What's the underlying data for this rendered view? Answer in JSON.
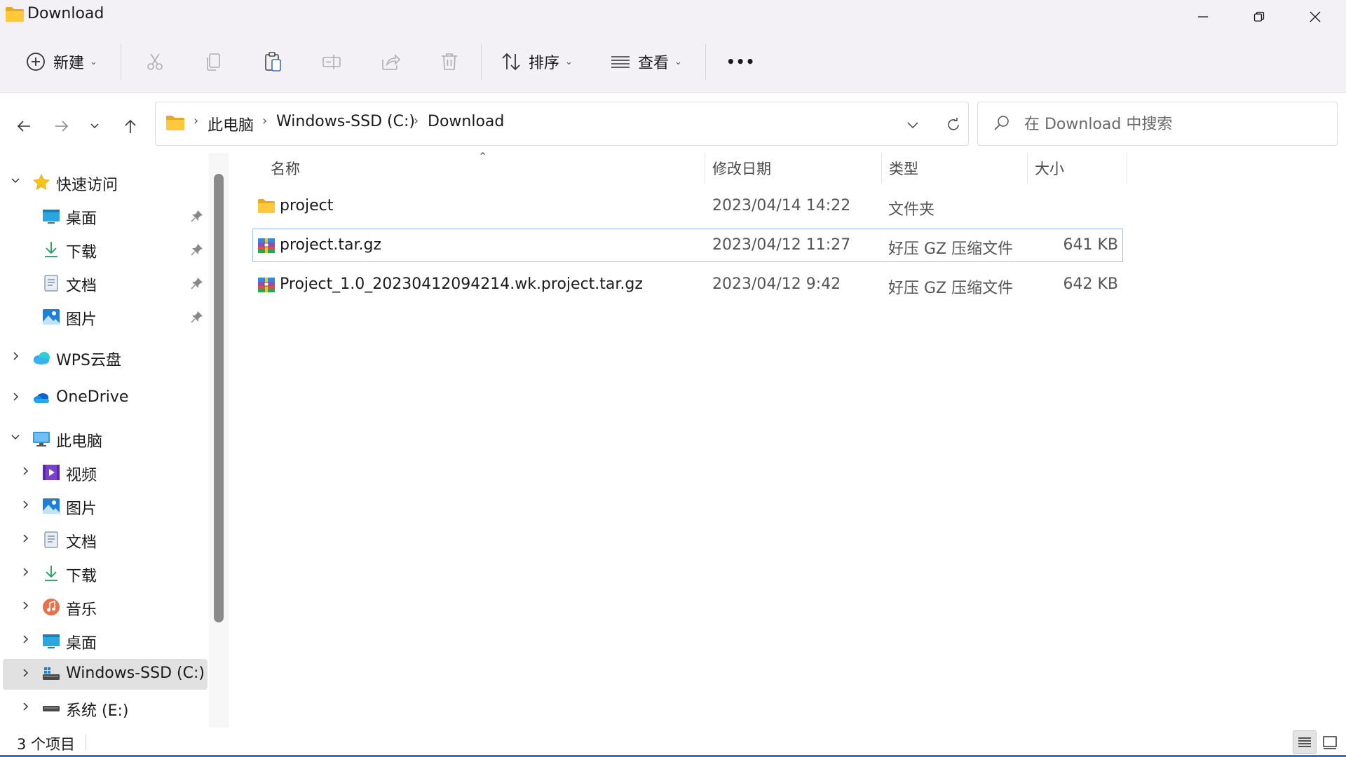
{
  "window": {
    "title": "Download",
    "minimize_icon": "minimize-icon",
    "maximize_icon": "restore-icon",
    "close_icon": "close-icon"
  },
  "toolbar": {
    "new_label": "新建",
    "sort_label": "排序",
    "view_label": "查看",
    "more_label": "•••",
    "icons": [
      "add-circle-icon",
      "cut-icon",
      "copy-icon",
      "paste-icon",
      "rename-icon",
      "share-icon",
      "delete-icon",
      "sort-icon",
      "view-list-icon",
      "more-icon"
    ]
  },
  "navigation": {
    "back_icon": "arrow-left-icon",
    "forward_icon": "arrow-right-icon",
    "recent_icon": "chevron-down-icon",
    "up_icon": "arrow-up-icon"
  },
  "address_bar": {
    "crumbs": [
      "此电脑",
      "Windows-SSD (C:)",
      "Download"
    ],
    "separator": "›"
  },
  "search": {
    "placeholder": "在 Download 中搜索"
  },
  "sidebar": {
    "quick_access": {
      "label": "快速访问",
      "items": [
        {
          "label": "桌面",
          "icon": "desktop-icon",
          "pinned": true
        },
        {
          "label": "下载",
          "icon": "download-icon",
          "pinned": true
        },
        {
          "label": "文档",
          "icon": "document-icon",
          "pinned": true
        },
        {
          "label": "图片",
          "icon": "pictures-icon",
          "pinned": true
        }
      ]
    },
    "wps_cloud": {
      "label": "WPS云盘"
    },
    "onedrive": {
      "label": "OneDrive"
    },
    "this_pc": {
      "label": "此电脑",
      "items": [
        {
          "label": "视频",
          "icon": "videos-icon"
        },
        {
          "label": "图片",
          "icon": "pictures-icon"
        },
        {
          "label": "文档",
          "icon": "document-icon"
        },
        {
          "label": "下载",
          "icon": "download-icon"
        },
        {
          "label": "音乐",
          "icon": "music-icon"
        },
        {
          "label": "桌面",
          "icon": "desktop-icon"
        },
        {
          "label": "Windows-SSD (C:)",
          "icon": "drive-icon",
          "selected": true
        },
        {
          "label": "系统 (E:)",
          "icon": "drive-icon"
        }
      ]
    }
  },
  "file_list": {
    "columns": [
      "名称",
      "修改日期",
      "类型",
      "大小"
    ],
    "sorted_by": "名称",
    "rows": [
      {
        "name": "project",
        "modified": "2023/04/14 14:22",
        "type": "文件夹",
        "size": "",
        "icon": "folder-icon"
      },
      {
        "name": "project.tar.gz",
        "modified": "2023/04/12 11:27",
        "type": "好压 GZ 压缩文件",
        "size": "641 KB",
        "icon": "archive-icon"
      },
      {
        "name": "Project_1.0_20230412094214.wk.project.tar.gz",
        "modified": "2023/04/12 9:42",
        "type": "好压 GZ 压缩文件",
        "size": "642 KB",
        "icon": "archive-icon"
      }
    ]
  },
  "status_bar": {
    "item_count": "3 个项目"
  },
  "colors": {
    "chrome_background": "#f3f0f6",
    "selection_border": "#99c5ee",
    "accent": "#3b6fb6"
  }
}
